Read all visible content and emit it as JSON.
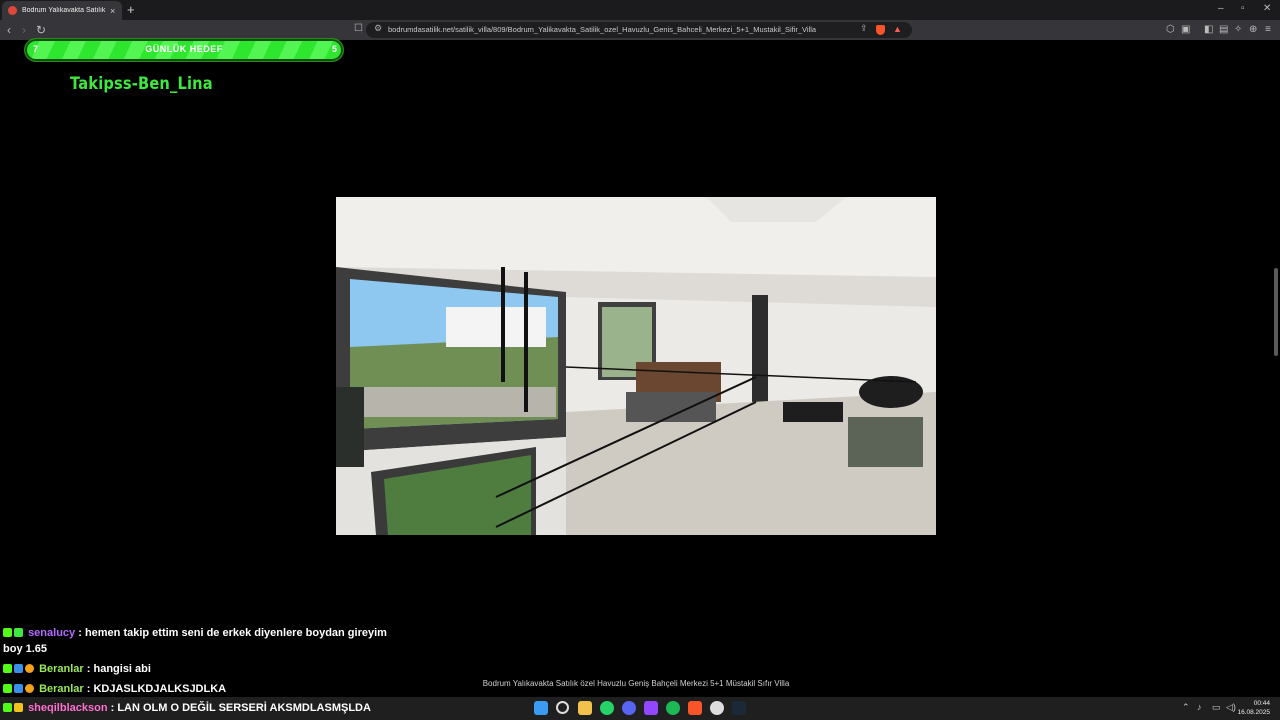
{
  "browser": {
    "tab_title": "Bodrum Yalıkavakta Satılık özel Havuzlu",
    "tab_close": "×",
    "new_tab": "+",
    "url": "bodrumdasatilik.net/satilik_villa/809/Bodrum_Yalikavakta_Satilik_ozel_Havuzlu_Genis_Bahceli_Merkezi_5+1_Mustakil_Sifir_Villa",
    "icons": {
      "back": "back-icon",
      "forward": "forward-icon",
      "reload": "reload-icon",
      "bookmark": "bookmark-icon",
      "share": "share-icon",
      "shields": "brave-shields-icon",
      "rewards": "brave-rewards-icon",
      "menu": "menu-icon"
    }
  },
  "overlay": {
    "goal_start": "7",
    "goal_label": "GÜNLÜK HEDEF",
    "goal_target": "5",
    "goal_color": "#2ee62e",
    "follow_text": "Takipss-Ben_Lina"
  },
  "listing": {
    "caption": "Bodrum Yalıkavakta Satılık özel Havuzlu Geniş Bahçeli Merkezi 5+1 Müstakil Sıfır Villa"
  },
  "chat": [
    {
      "user": "senalucy",
      "sep": " : ",
      "message": "hemen takip ettim seni de erkek diyenlere boydan gireyim",
      "cont": "boy 1.65",
      "color": "#b46cff"
    },
    {
      "user": "Beranlar",
      "sep": " : ",
      "message": "hangisi abi",
      "color": "#9ae85a"
    },
    {
      "user": "Beranlar",
      "sep": " : ",
      "message": "KDJASLKDJALKSJDLKA",
      "color": "#9ae85a"
    },
    {
      "user": "sheqilblackson",
      "sep": " : ",
      "message": "LAN OLM O DEĞİL SERSERİ AKSMDLASMŞLDA",
      "color": "#ff6ed1"
    }
  ],
  "taskbar": {
    "time": "00:44",
    "date": "16.08.2025"
  }
}
